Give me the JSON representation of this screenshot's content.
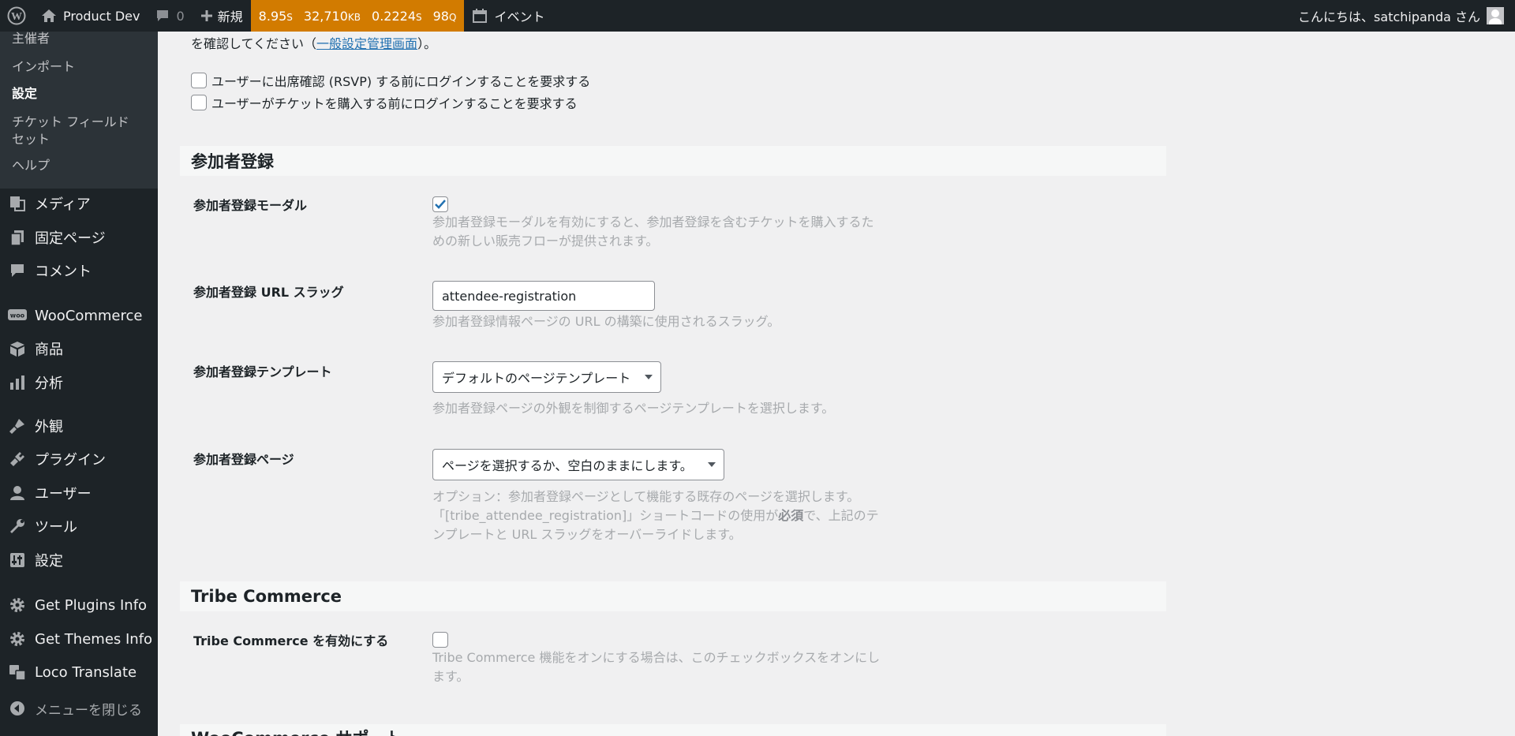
{
  "admin_bar": {
    "site_name": "Product Dev",
    "comments_count": "0",
    "new_label": "新規",
    "perf": {
      "time": "8.95",
      "time_unit": "S",
      "memory": "32,710",
      "memory_unit": "KB",
      "query_time": "0.2224",
      "query_time_unit": "S",
      "queries": "98",
      "queries_unit": "Q"
    },
    "events_label": "イベント",
    "greeting": "こんにちは、satchipanda さん"
  },
  "sidebar": {
    "submenu": [
      {
        "label": "主催者"
      },
      {
        "label": "インポート"
      },
      {
        "label": "設定"
      },
      {
        "label": "チケット フィールドセット"
      },
      {
        "label": "ヘルプ"
      }
    ],
    "menu": [
      {
        "label": "メディア",
        "icon": "media-icon"
      },
      {
        "label": "固定ページ",
        "icon": "pages-icon"
      },
      {
        "label": "コメント",
        "icon": "comments-icon"
      },
      {
        "label": "WooCommerce",
        "icon": "woocommerce-icon"
      },
      {
        "label": "商品",
        "icon": "products-icon"
      },
      {
        "label": "分析",
        "icon": "analytics-icon"
      },
      {
        "label": "外観",
        "icon": "appearance-icon"
      },
      {
        "label": "プラグイン",
        "icon": "plugins-icon"
      },
      {
        "label": "ユーザー",
        "icon": "users-icon"
      },
      {
        "label": "ツール",
        "icon": "tools-icon"
      },
      {
        "label": "設定",
        "icon": "settings-icon"
      },
      {
        "label": "Get Plugins Info",
        "icon": "gear-icon"
      },
      {
        "label": "Get Themes Info",
        "icon": "gear-icon"
      },
      {
        "label": "Loco Translate",
        "icon": "translate-icon"
      }
    ],
    "collapse_label": "メニューを閉じる"
  },
  "content": {
    "top_note_prefix": "を確認してください（",
    "top_note_link": "一般設定管理画面",
    "top_note_suffix": "）。",
    "login_rsvp_label": "ユーザーに出席確認 (RSVP) する前にログインすることを要求する",
    "login_ticket_label": "ユーザーがチケットを購入する前にログインすることを要求する",
    "attendee_section": {
      "heading": "参加者登録",
      "modal_label": "参加者登録モーダル",
      "modal_checked": true,
      "modal_desc": "参加者登録モーダルを有効にすると、参加者登録を含むチケットを購入するための新しい販売フローが提供されます。",
      "slug_label": "参加者登録 URL スラッグ",
      "slug_value": "attendee-registration",
      "slug_desc": "参加者登録情報ページの URL の構築に使用されるスラッグ。",
      "template_label": "参加者登録テンプレート",
      "template_value": "デフォルトのページテンプレート",
      "template_desc": "参加者登録ページの外観を制御するページテンプレートを選択します。",
      "page_label": "参加者登録ページ",
      "page_value": "ページを選択するか、空白のままにします。",
      "page_desc_1": "オプション：参加者登録ページとして機能する既存のページを選択します。「[tribe_attendee_registration]」ショートコードの使用が",
      "page_desc_bold": "必須",
      "page_desc_2": "で、上記のテンプレートと URL スラッグをオーバーライドします。"
    },
    "tribe_section": {
      "heading": "Tribe Commerce",
      "enable_label": "Tribe Commerce を有効にする",
      "enable_checked": false,
      "enable_desc": "Tribe Commerce 機能をオンにする場合は、このチェックボックスをオンにします。"
    },
    "woo_section": {
      "heading": "WooCommerce サポート"
    }
  }
}
